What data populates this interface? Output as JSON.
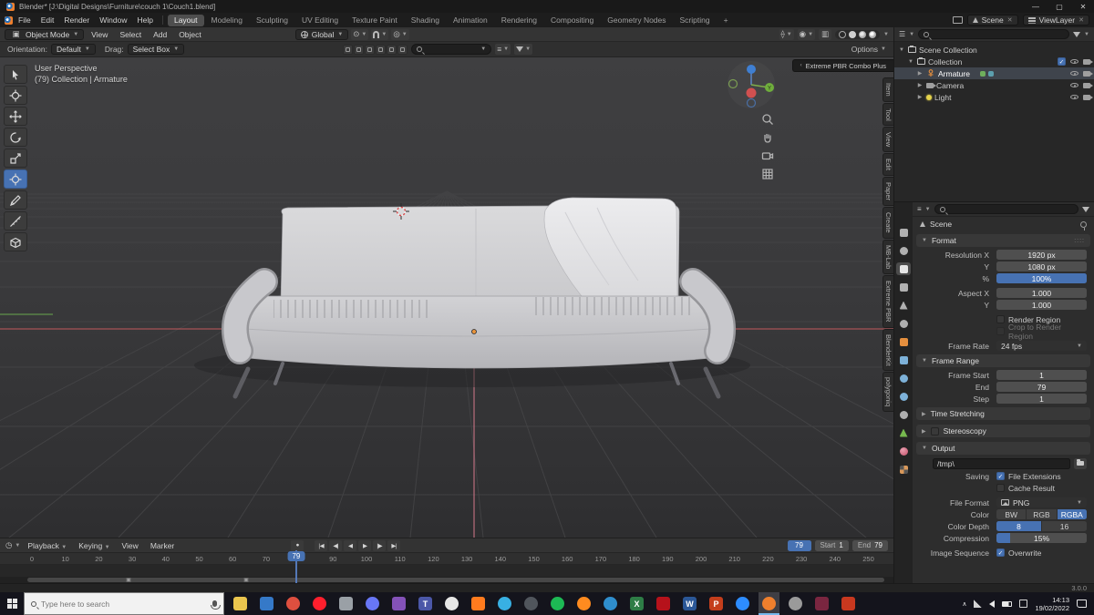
{
  "window": {
    "title": "Blender* [J:\\Digital Designs\\Furniture\\couch 1\\Couch1.blend]",
    "minimize": "—",
    "maximize": "▢",
    "close": "✕"
  },
  "menu_bar": {
    "menus": [
      "File",
      "Edit",
      "Render",
      "Window",
      "Help"
    ],
    "workspaces": [
      "Layout",
      "Modeling",
      "Sculpting",
      "UV Editing",
      "Texture Paint",
      "Shading",
      "Animation",
      "Rendering",
      "Compositing",
      "Geometry Nodes",
      "Scripting"
    ],
    "add_tab": "+",
    "active_workspace": "Layout",
    "scene_label": "Scene",
    "viewlayer_label": "ViewLayer"
  },
  "tool_header": {
    "mode": "Object Mode",
    "menus": [
      "View",
      "Select",
      "Add",
      "Object"
    ],
    "orientation": "Global",
    "options_label": "Options"
  },
  "tool_settings": {
    "orientation_label": "Orientation:",
    "orientation_value": "Default",
    "drag_label": "Drag:",
    "drag_value": "Select Box"
  },
  "viewport": {
    "view_label": "User Perspective",
    "context_label": "(79) Collection | Armature",
    "addon_button": "Extreme PBR Combo Plus",
    "axis_y": "Y"
  },
  "npanel_tabs": [
    "Item",
    "Tool",
    "View",
    "Edit",
    "Paper",
    "Create",
    "MB-Lab",
    "Extreme PBR",
    "BlenderKit",
    "polygoniq"
  ],
  "outliner": {
    "rows": [
      {
        "label": "Scene Collection"
      },
      {
        "label": "Collection"
      },
      {
        "label": "Armature"
      },
      {
        "label": "Camera"
      },
      {
        "label": "Light"
      }
    ]
  },
  "properties": {
    "breadcrumb": "Scene",
    "format": {
      "title": "Format",
      "resolution_x_label": "Resolution X",
      "resolution_x": "1920 px",
      "resolution_y_label": "Y",
      "resolution_y": "1080 px",
      "percent_label": "%",
      "percent": "100%",
      "aspect_x_label": "Aspect X",
      "aspect_x": "1.000",
      "aspect_y_label": "Y",
      "aspect_y": "1.000",
      "render_region": "Render Region",
      "crop_to_render_region": "Crop to Render Region",
      "frame_rate_label": "Frame Rate",
      "frame_rate": "24 fps"
    },
    "frame_range": {
      "title": "Frame Range",
      "frame_start_label": "Frame Start",
      "frame_start": "1",
      "end_label": "End",
      "end": "79",
      "step_label": "Step",
      "step": "1"
    },
    "time_stretching_title": "Time Stretching",
    "stereoscopy_title": "Stereoscopy",
    "output": {
      "title": "Output",
      "path": "/tmp\\",
      "saving_label": "Saving",
      "file_extensions": "File Extensions",
      "cache_result": "Cache Result",
      "file_format_label": "File Format",
      "file_format": "PNG",
      "color_label": "Color",
      "color_bw": "BW",
      "color_rgb": "RGB",
      "color_rgba": "RGBA",
      "depth_label": "Color Depth",
      "depth_8": "8",
      "depth_16": "16",
      "compression_label": "Compression",
      "compression": "15%",
      "compression_pct": 15,
      "sequence_label": "Image Sequence",
      "overwrite": "Overwrite"
    }
  },
  "timeline": {
    "menus": [
      "Playback",
      "Keying",
      "View",
      "Marker"
    ],
    "transport": [
      "|◀",
      "◀|",
      "◀",
      "▶",
      "|▶",
      "▶|"
    ],
    "current_frame": 79,
    "frame_field": "79",
    "ruler_start": 0,
    "ruler_end": 250,
    "ruler_step": 10,
    "start_label": "Start",
    "start_value": "1",
    "end_label": "End",
    "end_value": "79",
    "keyframes": [
      29,
      64
    ]
  },
  "status_bar": {
    "version": "3.0.0"
  },
  "taskbar": {
    "search_placeholder": "Type here to search",
    "tray_time": "14:13",
    "tray_date": "19/02/2022",
    "apps": [
      {
        "name": "file-explorer",
        "color": "#eac54e"
      },
      {
        "name": "photos",
        "color": "#3579c8"
      },
      {
        "name": "chrome",
        "color": "#de4f3f",
        "round": true
      },
      {
        "name": "opera",
        "color": "#ff1f2d",
        "round": true
      },
      {
        "name": "gimp",
        "color": "#9aa0a6"
      },
      {
        "name": "discord",
        "color": "#6876f5",
        "round": true
      },
      {
        "name": "krita",
        "color": "#8452b8"
      },
      {
        "name": "teams",
        "color": "#4b57a8",
        "glyph": "T"
      },
      {
        "name": "steam",
        "color": "#e6e6e6",
        "round": true
      },
      {
        "name": "vlc",
        "color": "#ff7b1e"
      },
      {
        "name": "skype",
        "color": "#38b0e3",
        "round": true
      },
      {
        "name": "obs",
        "color": "#50555c",
        "round": true
      },
      {
        "name": "spotify",
        "color": "#1db954",
        "round": true
      },
      {
        "name": "firefox",
        "color": "#ff8b1f",
        "round": true
      },
      {
        "name": "edge",
        "color": "#2f8ecd",
        "round": true
      },
      {
        "name": "excel",
        "color": "#2e7d46",
        "glyph": "X"
      },
      {
        "name": "netflix",
        "color": "#b6121b"
      },
      {
        "name": "word",
        "color": "#2b5797",
        "glyph": "W"
      },
      {
        "name": "powerpoint",
        "color": "#c43e1c",
        "glyph": "P"
      },
      {
        "name": "zoom",
        "color": "#2d8cff",
        "round": true
      },
      {
        "name": "blender",
        "color": "#ee7f2d",
        "round": true,
        "active": true
      },
      {
        "name": "unity",
        "color": "#9a9a9a",
        "round": true
      },
      {
        "name": "premiere",
        "color": "#7a2640"
      },
      {
        "name": "media-player",
        "color": "#c8381f"
      }
    ]
  }
}
